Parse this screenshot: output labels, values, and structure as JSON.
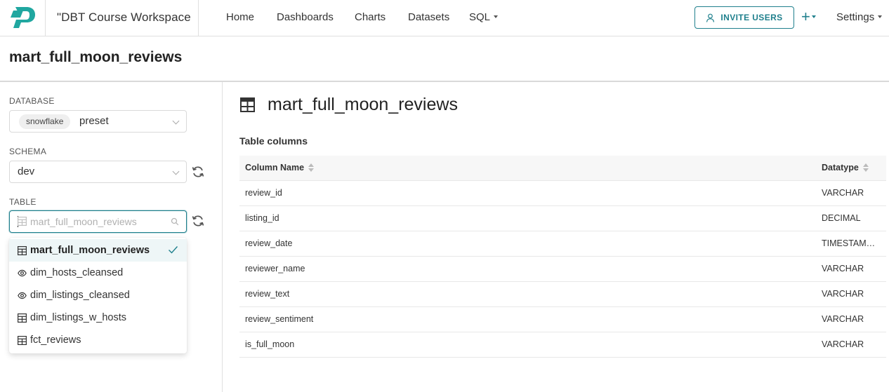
{
  "header": {
    "workspace_name": "\"DBT Course Workspace",
    "nav": [
      {
        "label": "Home"
      },
      {
        "label": "Dashboards"
      },
      {
        "label": "Charts"
      },
      {
        "label": "Datasets"
      },
      {
        "label": "SQL"
      }
    ],
    "invite_label": "INVITE USERS",
    "plus_label": "+",
    "settings_label": "Settings"
  },
  "page": {
    "title": "mart_full_moon_reviews"
  },
  "left": {
    "database_label": "DATABASE",
    "database_tag": "snowflake",
    "database_name": "preset",
    "schema_label": "SCHEMA",
    "schema_value": "dev",
    "table_label": "TABLE",
    "table_placeholder": "mart_full_moon_reviews",
    "dropdown": [
      {
        "label": "mart_full_moon_reviews",
        "kind": "table",
        "selected": true
      },
      {
        "label": "dim_hosts_cleansed",
        "kind": "view",
        "selected": false
      },
      {
        "label": "dim_listings_cleansed",
        "kind": "view",
        "selected": false
      },
      {
        "label": "dim_listings_w_hosts",
        "kind": "table",
        "selected": false
      },
      {
        "label": "fct_reviews",
        "kind": "table",
        "selected": false
      }
    ]
  },
  "content": {
    "title": "mart_full_moon_reviews",
    "section_title": "Table columns",
    "columns_header": {
      "name": "Column Name",
      "type": "Datatype"
    },
    "rows": [
      {
        "name": "review_id",
        "type": "VARCHAR"
      },
      {
        "name": "listing_id",
        "type": "DECIMAL"
      },
      {
        "name": "review_date",
        "type": "TIMESTAMP_NTZ"
      },
      {
        "name": "reviewer_name",
        "type": "VARCHAR"
      },
      {
        "name": "review_text",
        "type": "VARCHAR"
      },
      {
        "name": "review_sentiment",
        "type": "VARCHAR"
      },
      {
        "name": "is_full_moon",
        "type": "VARCHAR"
      }
    ]
  },
  "colors": {
    "brand": "#20a7a0",
    "accent": "#20808d",
    "selected_bg": "#eef6f7"
  }
}
